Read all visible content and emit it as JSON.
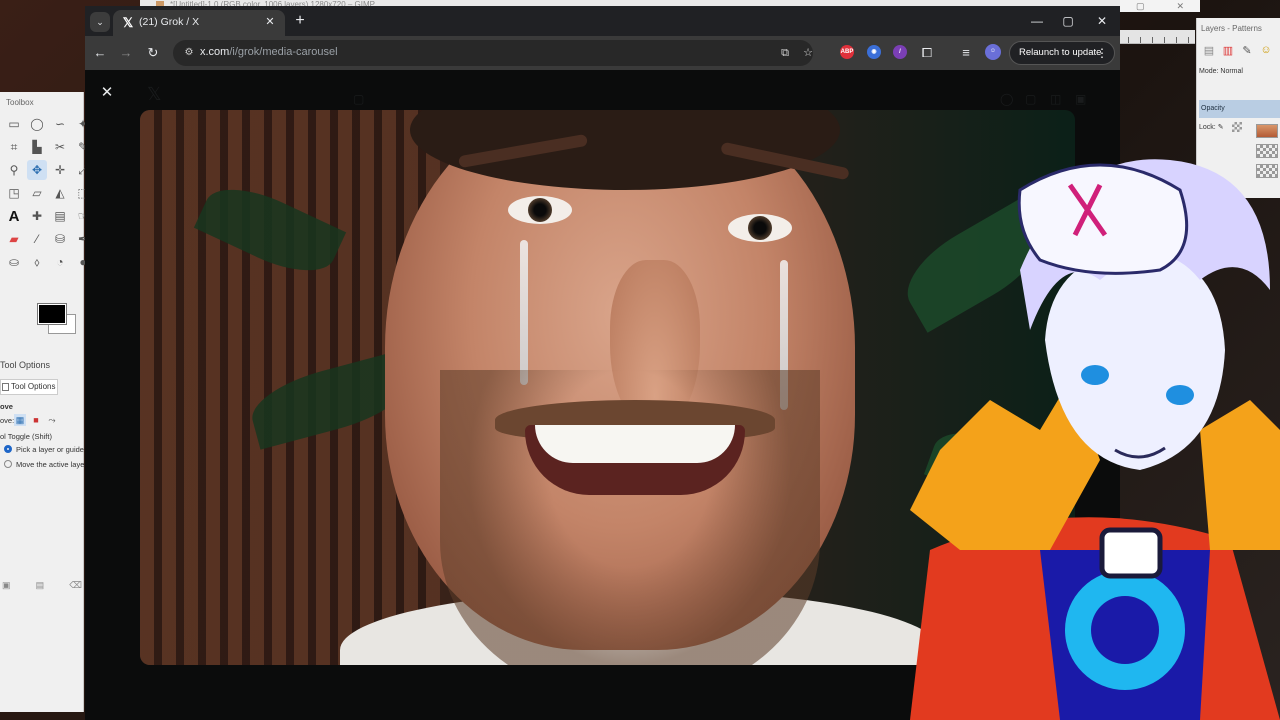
{
  "gimp": {
    "window_title": "*[Untitled]-1.0 (RGB color, 1006 layers) 1280x720 – GIMP",
    "toolbox": {
      "title": "Toolbox",
      "tool_options_title": "Tool Options",
      "tool_options_tab": "Tool Options",
      "move_label": "ove",
      "move_prefix": "ove:",
      "tool_toggle": "ol Toggle  (Shift)",
      "option_pick": "Pick a layer or guide",
      "option_move": "Move the active layer"
    },
    "layers": {
      "title": "Layers - Patterns",
      "mode": "Mode: Normal",
      "opacity": "Opacity",
      "lock": "Lock:"
    }
  },
  "browser": {
    "tab_title": "(21) Grok / X",
    "url_host": "x.com",
    "url_path": "/i/grok/media-carousel",
    "relaunch_label": "Relaunch to update",
    "extensions": [
      {
        "name": "abp-icon",
        "label": "ABP",
        "color": "#e0303a"
      },
      {
        "name": "extension-blue-icon",
        "label": "",
        "color": "#3b6fd8"
      },
      {
        "name": "extension-pen-icon",
        "label": "",
        "color": "#7b3fb5"
      }
    ]
  },
  "viewer": {
    "close_label": "✕"
  }
}
